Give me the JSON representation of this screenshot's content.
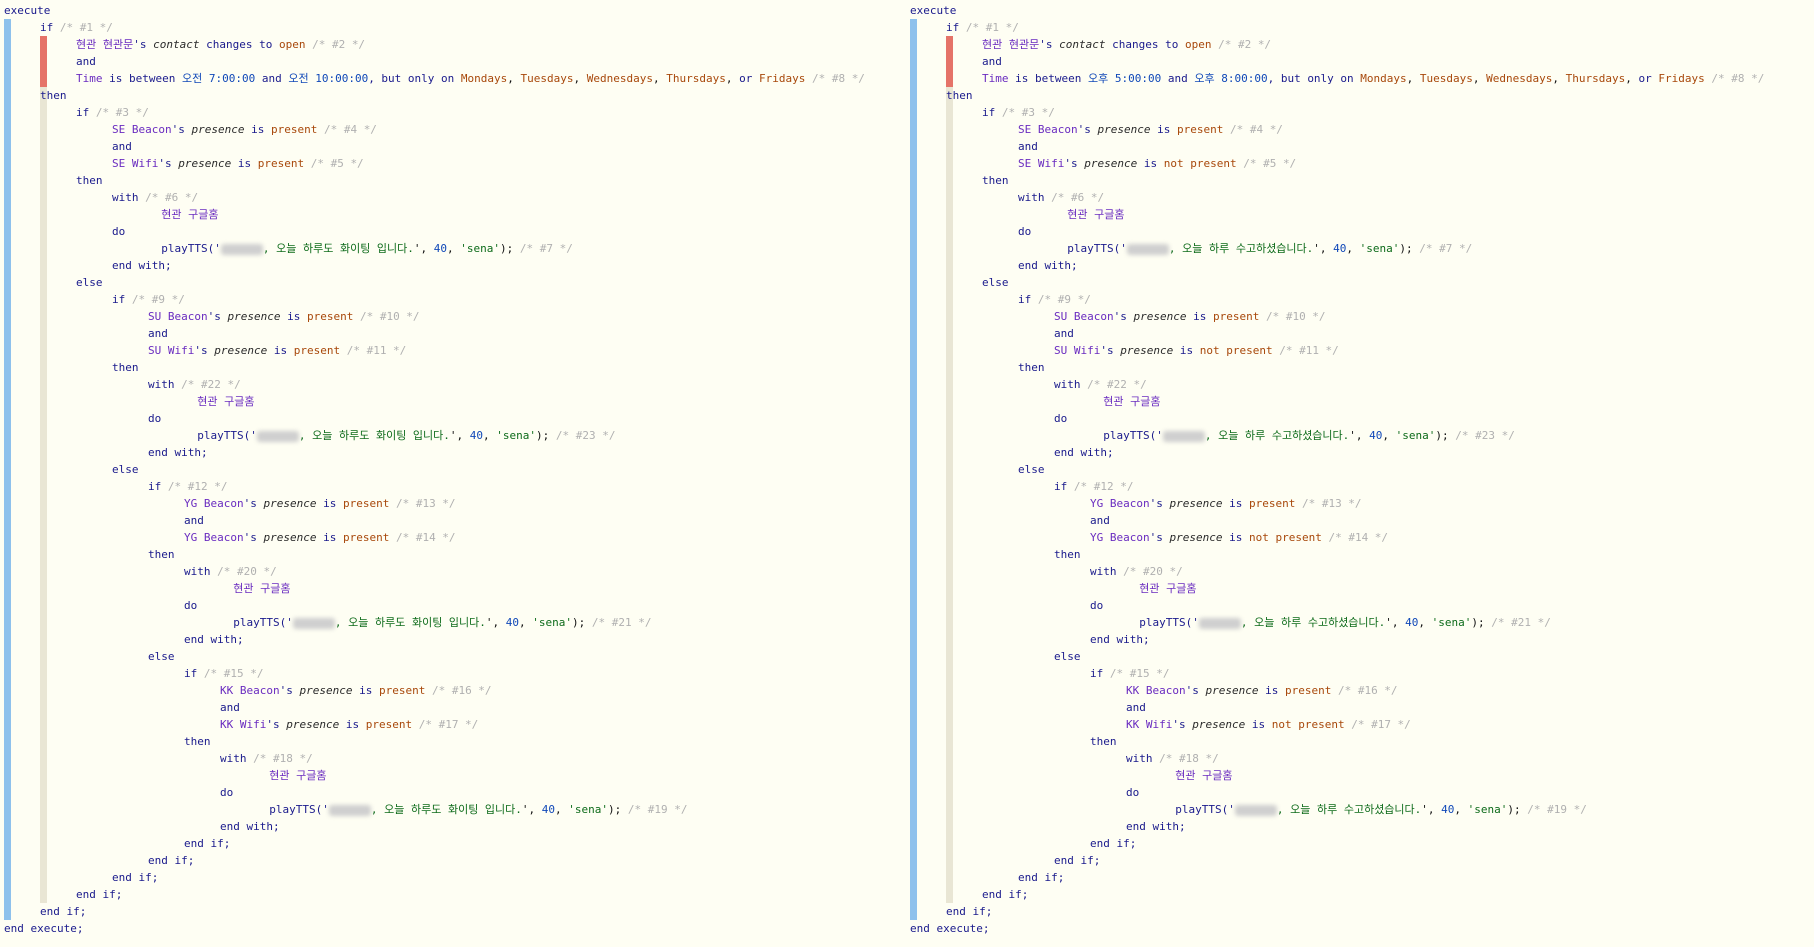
{
  "panels": [
    {
      "id": "morning",
      "device_name": "현관 현관문",
      "contact_attr": "contact",
      "contact_value": "open",
      "time_start": "오전 7:00:00",
      "time_end": "오전 10:00:00",
      "days": [
        "Mondays",
        "Tuesdays",
        "Wednesdays",
        "Thursdays",
        "Fridays"
      ],
      "speaker": "현관 구글홈",
      "message": ", 오늘 하루도 화이팅 입니다.",
      "wifi_presence": "present",
      "checks": [
        {
          "beacon": "SE Beacon",
          "wifi": "SE Wifi",
          "if_id": "#3",
          "b_id": "#4",
          "w_id": "#5",
          "with_id": "#6",
          "tts_id": "#7"
        },
        {
          "beacon": "SU Beacon",
          "wifi": "SU Wifi",
          "if_id": "#9",
          "b_id": "#10",
          "w_id": "#11",
          "with_id": "#22",
          "tts_id": "#23"
        },
        {
          "beacon": "YG Beacon",
          "wifi": "YG Beacon",
          "if_id": "#12",
          "b_id": "#13",
          "w_id": "#14",
          "with_id": "#20",
          "tts_id": "#21"
        },
        {
          "beacon": "KK Beacon",
          "wifi": "KK Wifi",
          "if_id": "#15",
          "b_id": "#16",
          "w_id": "#17",
          "with_id": "#18",
          "tts_id": "#19"
        }
      ]
    },
    {
      "id": "evening",
      "device_name": "현관 현관문",
      "contact_attr": "contact",
      "contact_value": "open",
      "time_start": "오후 5:00:00",
      "time_end": "오후 8:00:00",
      "days": [
        "Mondays",
        "Tuesdays",
        "Wednesdays",
        "Thursdays",
        "Fridays"
      ],
      "speaker": "현관 구글홈",
      "message": ", 오늘 하루 수고하셨습니다.",
      "wifi_presence": "not present",
      "checks": [
        {
          "beacon": "SE Beacon",
          "wifi": "SE Wifi",
          "if_id": "#3",
          "b_id": "#4",
          "w_id": "#5",
          "with_id": "#6",
          "tts_id": "#7"
        },
        {
          "beacon": "SU Beacon",
          "wifi": "SU Wifi",
          "if_id": "#9",
          "b_id": "#10",
          "w_id": "#11",
          "with_id": "#22",
          "tts_id": "#23"
        },
        {
          "beacon": "YG Beacon",
          "wifi": "YG Beacon",
          "if_id": "#12",
          "b_id": "#13",
          "w_id": "#14",
          "with_id": "#20",
          "tts_id": "#21"
        },
        {
          "beacon": "KK Beacon",
          "wifi": "KK Wifi",
          "if_id": "#15",
          "b_id": "#16",
          "w_id": "#17",
          "with_id": "#18",
          "tts_id": "#19"
        }
      ]
    }
  ],
  "keywords": {
    "execute": "execute",
    "end_execute": "end execute;",
    "if": "if",
    "then": "then",
    "else": "else",
    "and": "and",
    "end_if": "end if;",
    "with": "with",
    "do": "do",
    "end_with": "end with;",
    "play": "playTTS('",
    "volume": "40",
    "voice": "'sena'",
    "presence": "presence",
    "is": "is",
    "possessive": "'s",
    "time": "Time",
    "is_between": "is between",
    "but_only_on": ", but only on",
    "or": "or",
    "changes_to": "changes to"
  },
  "colors": {
    "accent_bar": "#8ec1ec",
    "trigger_bar": "#e57368",
    "tree": "#3c6fb4"
  }
}
